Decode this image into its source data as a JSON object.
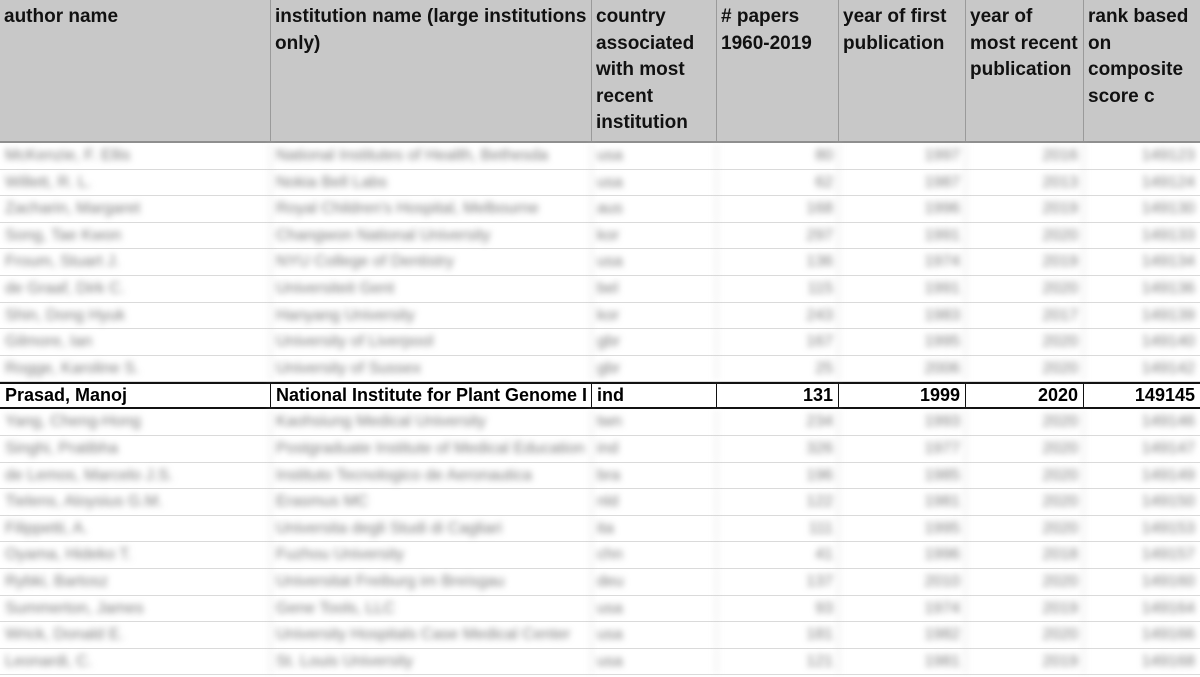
{
  "headers": [
    "author name",
    "institution name (large institutions only)",
    "country associated with most recent institution",
    "# papers 1960-2019",
    "year of first publication",
    "year of most recent publication",
    "rank based on composite score c"
  ],
  "rows_before": [
    [
      "McKenzie, F. Ellis",
      "National Institutes of Health, Bethesda",
      "usa",
      "80",
      "1997",
      "2016",
      "149123"
    ],
    [
      "Willett, R. L.",
      "Nokia Bell Labs",
      "usa",
      "62",
      "1987",
      "2013",
      "149124"
    ],
    [
      "Zacharin, Margaret",
      "Royal Children's Hospital, Melbourne",
      "aus",
      "168",
      "1996",
      "2019",
      "149130"
    ],
    [
      "Song, Tae Kwon",
      "Changwon National University",
      "kor",
      "297",
      "1991",
      "2020",
      "149133"
    ],
    [
      "Froum, Stuart J.",
      "NYU College of Dentistry",
      "usa",
      "136",
      "1974",
      "2019",
      "149134"
    ],
    [
      "de Graaf, Dirk C.",
      "Universiteit Gent",
      "bel",
      "115",
      "1991",
      "2020",
      "149136"
    ],
    [
      "Shin, Dong Hyuk",
      "Hanyang University",
      "kor",
      "243",
      "1983",
      "2017",
      "149139"
    ],
    [
      "Gilmore, Ian",
      "University of Liverpool",
      "gbr",
      "167",
      "1995",
      "2020",
      "149140"
    ],
    [
      "Rogge, Karoline S.",
      "University of Sussex",
      "gbr",
      "25",
      "2006",
      "2020",
      "149142"
    ]
  ],
  "highlight_row": [
    "Prasad, Manoj",
    "National Institute for Plant Genome I",
    "ind",
    "131",
    "1999",
    "2020",
    "149145"
  ],
  "rows_after": [
    [
      "Yang, Cheng-Hong",
      "Kaohsiung Medical University",
      "twn",
      "234",
      "1993",
      "2020",
      "149146"
    ],
    [
      "Singhi, Pratibha",
      "Postgraduate Institute of Medical Education",
      "ind",
      "326",
      "1977",
      "2020",
      "149147"
    ],
    [
      "de Lemos, Marcelo J.S.",
      "Instituto Tecnologico de Aeronautica",
      "bra",
      "196",
      "1985",
      "2020",
      "149149"
    ],
    [
      "Tielens, Aloysius G.M.",
      "Erasmus MC",
      "nld",
      "122",
      "1981",
      "2020",
      "149150"
    ],
    [
      "Filippetti, A.",
      "Universita degli Studi di Cagliari",
      "ita",
      "111",
      "1995",
      "2020",
      "149153"
    ],
    [
      "Oyama, Hideko T.",
      "Fuzhou University",
      "chn",
      "41",
      "1996",
      "2018",
      "149157"
    ],
    [
      "Rybki, Bartosz",
      "Universitat Freiburg im Breisgau",
      "deu",
      "137",
      "2010",
      "2020",
      "149160"
    ],
    [
      "Summerton, James",
      "Gene Tools, LLC",
      "usa",
      "93",
      "1974",
      "2019",
      "149164"
    ],
    [
      "Wrick, Donald E.",
      "University Hospitals Case Medical Center",
      "usa",
      "181",
      "1982",
      "2020",
      "149166"
    ],
    [
      "Leonardi, C.",
      "St. Louis University",
      "usa",
      "121",
      "1981",
      "2019",
      "149168"
    ]
  ]
}
